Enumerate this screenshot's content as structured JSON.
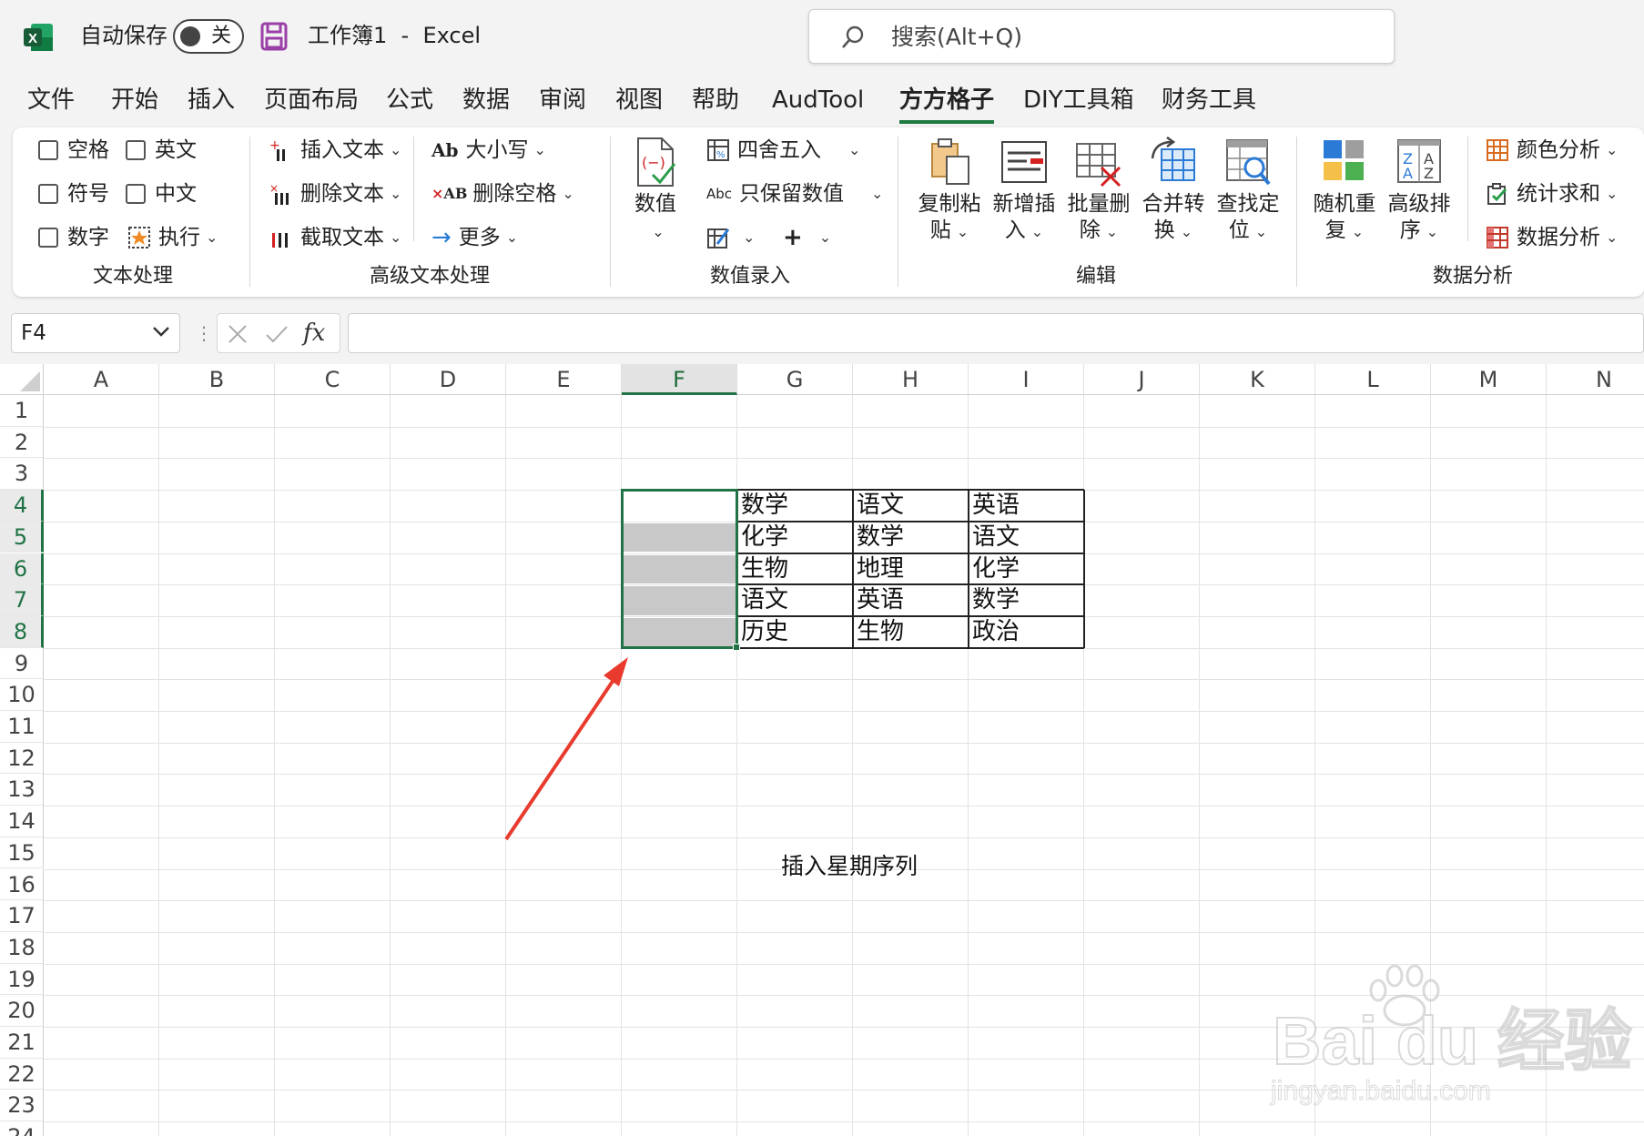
{
  "app": {
    "autosave_label": "自动保存",
    "autosave_state": "关",
    "doc_title": "工作簿1  -  Excel",
    "search_placeholder": "搜索(Alt+Q)"
  },
  "menu_tabs": [
    "文件",
    "开始",
    "插入",
    "页面布局",
    "公式",
    "数据",
    "审阅",
    "视图",
    "帮助",
    "AudTool",
    "方方格子",
    "DIY工具箱",
    "财务工具"
  ],
  "active_tab": "方方格子",
  "ribbon": {
    "text_processing": {
      "group_label": "文本处理",
      "checkbox_space": "空格",
      "checkbox_english": "英文",
      "checkbox_symbol": "符号",
      "checkbox_chinese": "中文",
      "checkbox_number": "数字",
      "execute": "执行"
    },
    "advanced_text": {
      "group_label": "高级文本处理",
      "insert_text": "插入文本",
      "delete_text": "删除文本",
      "extract_text": "截取文本",
      "case": "大小写",
      "delete_space": "删除空格",
      "more": "更多"
    },
    "value_entry": {
      "group_label": "数值录入",
      "value": "数值",
      "round": "四舍五入",
      "keep_values": "只保留数值",
      "plus": "+"
    },
    "edit": {
      "group_label": "编辑",
      "copy_paste_1": "复制粘",
      "copy_paste_2": "贴",
      "new_insert_1": "新增插",
      "new_insert_2": "入",
      "batch_delete_1": "批量删",
      "batch_delete_2": "除",
      "merge_convert_1": "合并转",
      "merge_convert_2": "换",
      "find_locate_1": "查找定",
      "find_locate_2": "位"
    },
    "data_analysis": {
      "group_label": "数据分析",
      "random_dup_1": "随机重",
      "random_dup_2": "复",
      "adv_sort_1": "高级排",
      "adv_sort_2": "序",
      "color_analysis": "颜色分析",
      "stat_sum": "统计求和",
      "data_analysis": "数据分析"
    }
  },
  "formula_bar": {
    "name_box": "F4",
    "fx": "fx",
    "formula": ""
  },
  "columns": [
    "A",
    "B",
    "C",
    "D",
    "E",
    "F",
    "G",
    "H",
    "I",
    "J",
    "K",
    "L",
    "M",
    "N"
  ],
  "selected_column": "F",
  "rows": [
    "1",
    "2",
    "3",
    "4",
    "5",
    "6",
    "7",
    "8",
    "9",
    "10",
    "11",
    "12",
    "13",
    "14",
    "15",
    "16",
    "17",
    "18",
    "19",
    "20",
    "21",
    "22",
    "23",
    "24"
  ],
  "selected_rows": [
    "4",
    "5",
    "6",
    "7",
    "8"
  ],
  "table": [
    [
      "数学",
      "语文",
      "英语"
    ],
    [
      "化学",
      "数学",
      "语文"
    ],
    [
      "生物",
      "地理",
      "化学"
    ],
    [
      "语文",
      "英语",
      "数学"
    ],
    [
      "历史",
      "生物",
      "政治"
    ]
  ],
  "annotation": "插入星期序列",
  "watermark": {
    "main": "Bai du 经验",
    "sub": "jingyan.baidu.com"
  },
  "colors": {
    "excel_green": "#217346",
    "selection_fill": "#c8c8c8",
    "arrow": "#e83b2e"
  }
}
